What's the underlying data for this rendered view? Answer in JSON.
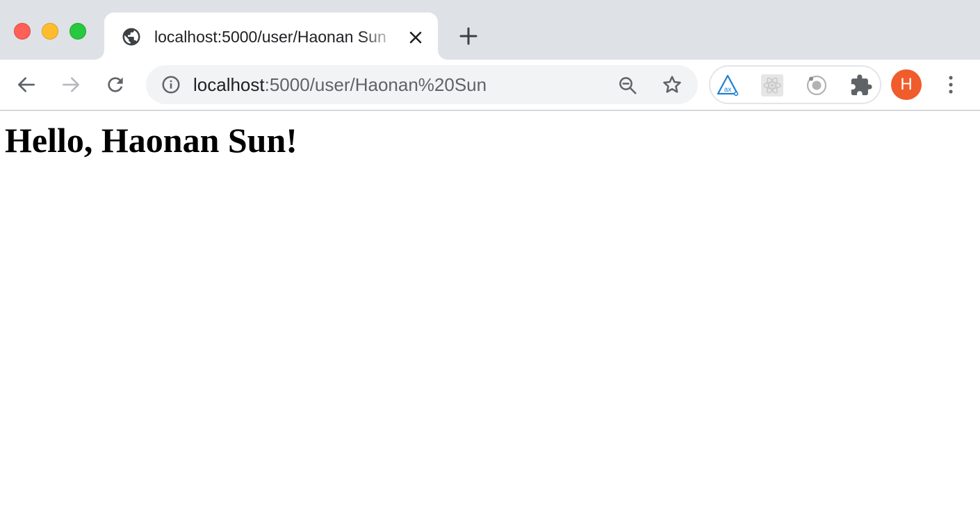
{
  "tab": {
    "title": "localhost:5000/user/Haonan Sun",
    "favicon": "globe-icon"
  },
  "omnibox": {
    "url_host": "localhost",
    "url_path": ":5000/user/Haonan%20Sun",
    "info_icon": "info-icon",
    "zoom_icon": "zoom-out-icon",
    "bookmark_icon": "star-icon"
  },
  "extensions": [
    {
      "name": "axe-devtools-icon",
      "color": "#1e7fd0"
    },
    {
      "name": "react-devtools-icon",
      "color": "#c9c9c9"
    },
    {
      "name": "ionic-devtools-icon",
      "color": "#a8a8a8"
    },
    {
      "name": "extensions-puzzle-icon",
      "color": "#5f6368"
    }
  ],
  "profile": {
    "initial": "H",
    "color": "#f05c2b"
  },
  "page": {
    "heading": "Hello, Haonan Sun!"
  },
  "colors": {
    "tabstrip": "#dee1e6",
    "omnibox": "#f1f3f4",
    "close": "#fe5f57",
    "minimize": "#febc2e",
    "maximize": "#28c840"
  }
}
